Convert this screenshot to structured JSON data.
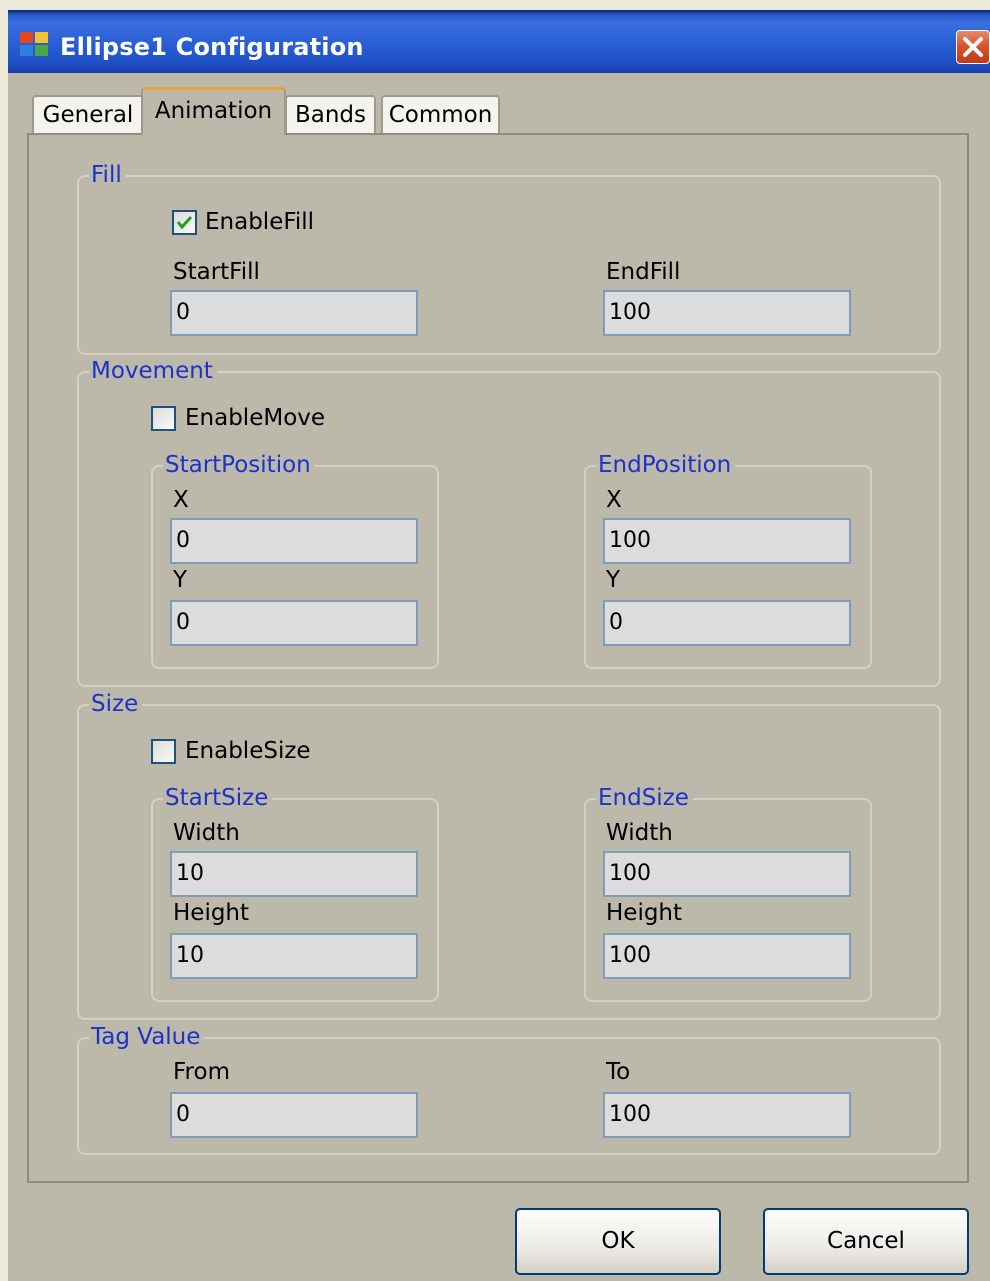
{
  "window": {
    "title": "Ellipse1 Configuration"
  },
  "tabs": [
    {
      "label": "General",
      "active": false
    },
    {
      "label": "Animation",
      "active": true
    },
    {
      "label": "Bands",
      "active": false
    },
    {
      "label": "Common",
      "active": false
    }
  ],
  "fill": {
    "legend": "Fill",
    "enable_label": "EnableFill",
    "enabled": true,
    "start_label": "StartFill",
    "start_value": "0",
    "end_label": "EndFill",
    "end_value": "100"
  },
  "movement": {
    "legend": "Movement",
    "enable_label": "EnableMove",
    "enabled": false,
    "start": {
      "legend": "StartPosition",
      "x_label": "X",
      "x_value": "0",
      "y_label": "Y",
      "y_value": "0"
    },
    "end": {
      "legend": "EndPosition",
      "x_label": "X",
      "x_value": "100",
      "y_label": "Y",
      "y_value": "0"
    }
  },
  "size": {
    "legend": "Size",
    "enable_label": "EnableSize",
    "enabled": false,
    "start": {
      "legend": "StartSize",
      "width_label": "Width",
      "width_value": "10",
      "height_label": "Height",
      "height_value": "10"
    },
    "end": {
      "legend": "EndSize",
      "width_label": "Width",
      "width_value": "100",
      "height_label": "Height",
      "height_value": "100"
    }
  },
  "tag_value": {
    "legend": "Tag Value",
    "from_label": "From",
    "from_value": "0",
    "to_label": "To",
    "to_value": "100"
  },
  "buttons": {
    "ok": "OK",
    "cancel": "Cancel"
  },
  "colors": {
    "title_bar": "#2b60d6",
    "legend_text": "#1c32c8",
    "dialog_bg": "#bcb9aa",
    "close_button": "#d9552e",
    "active_tab_accent": "#e8a23c"
  },
  "icons": {
    "app": "app-icon",
    "close": "close-icon",
    "check": "check-icon"
  }
}
